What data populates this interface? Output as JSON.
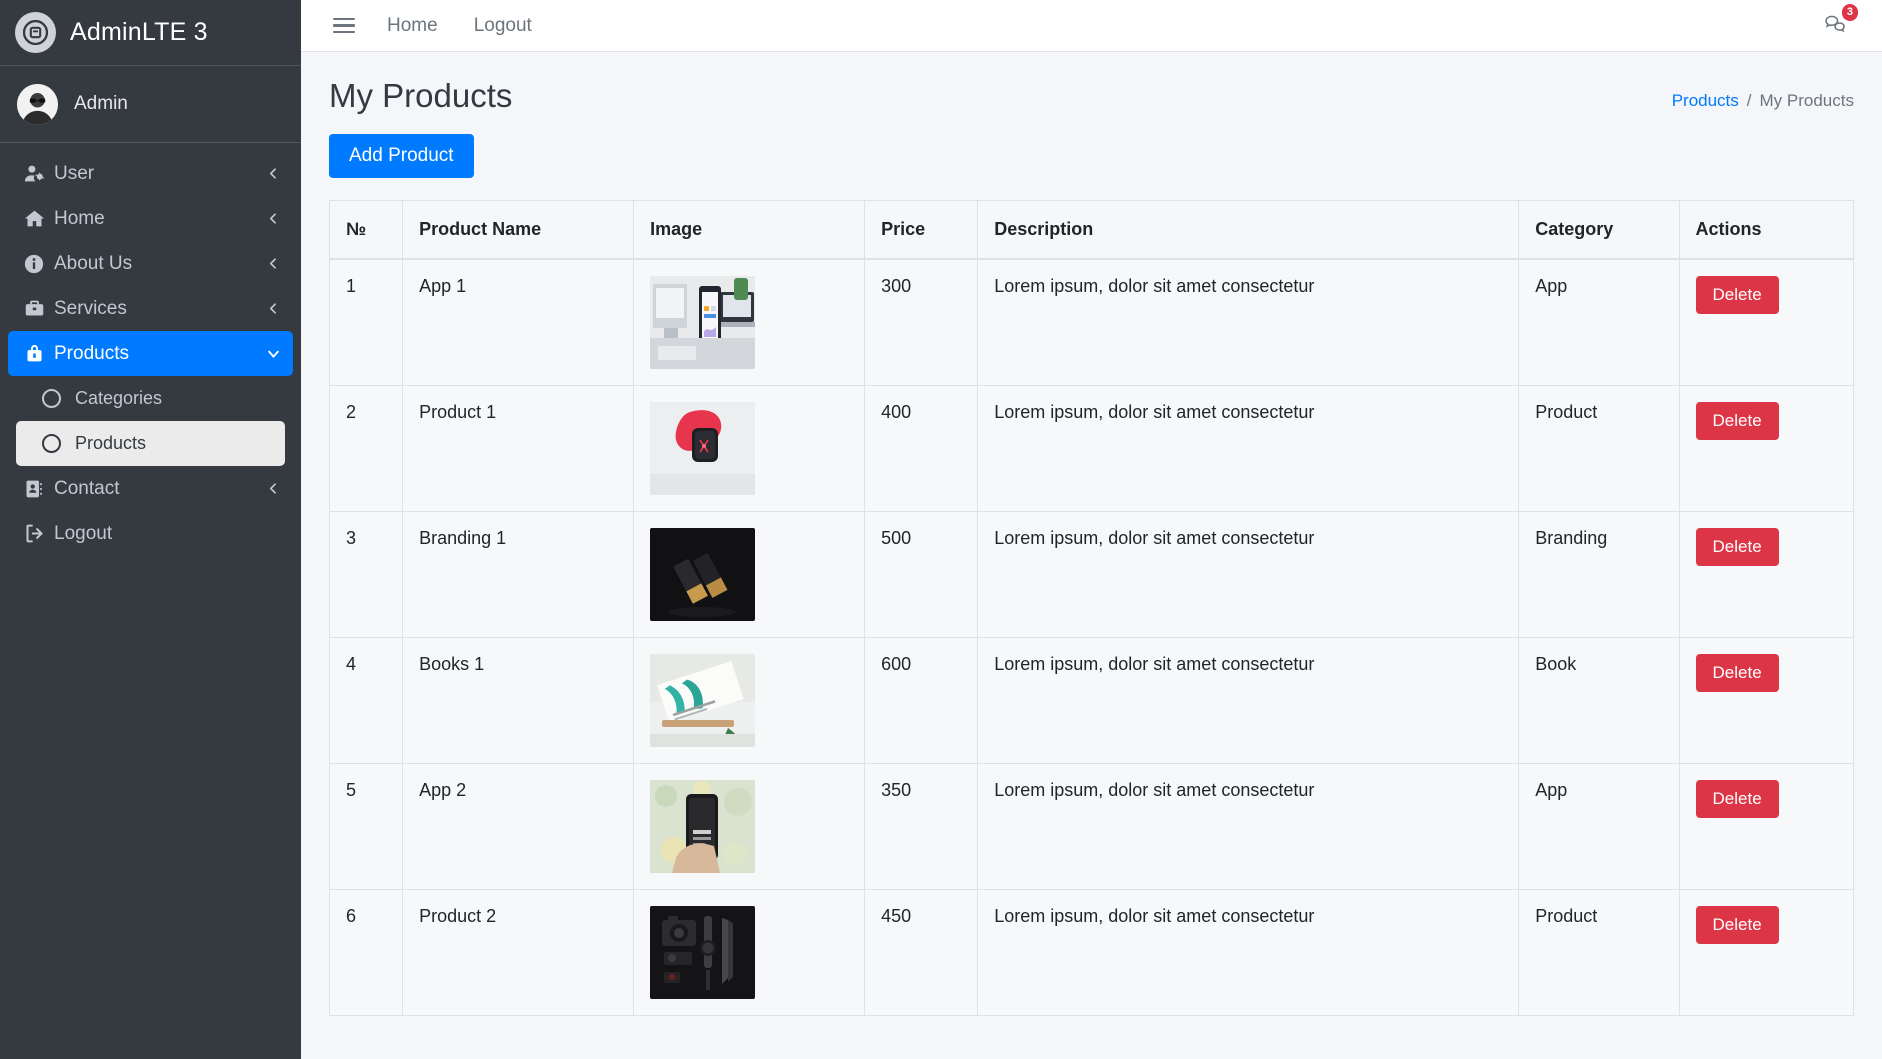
{
  "brand": {
    "title": "AdminLTE 3",
    "logo_icon": "adminlte-logo-icon"
  },
  "user_panel": {
    "name": "Admin",
    "avatar_icon": "user-avatar"
  },
  "sidebar": {
    "items": [
      {
        "label": "User",
        "icon": "user-cog-icon",
        "arrow": "chevron-left-icon",
        "active": false
      },
      {
        "label": "Home",
        "icon": "home-icon",
        "arrow": "chevron-left-icon",
        "active": false
      },
      {
        "label": "About Us",
        "icon": "info-circle-icon",
        "arrow": "chevron-left-icon",
        "active": false
      },
      {
        "label": "Services",
        "icon": "briefcase-icon",
        "arrow": "chevron-left-icon",
        "active": false
      },
      {
        "label": "Products",
        "icon": "lock-bag-icon",
        "arrow": "chevron-down-icon",
        "active": true
      },
      {
        "label": "Contact",
        "icon": "address-book-icon",
        "arrow": "chevron-left-icon",
        "active": false
      },
      {
        "label": "Logout",
        "icon": "sign-out-icon",
        "arrow": "",
        "active": false
      }
    ],
    "sub_items": [
      {
        "label": "Categories",
        "icon": "circle-icon",
        "active": false
      },
      {
        "label": "Products",
        "icon": "circle-icon",
        "active": true
      }
    ]
  },
  "navbar": {
    "burger_icon": "hamburger-menu-icon",
    "links": [
      {
        "label": "Home"
      },
      {
        "label": "Logout"
      }
    ],
    "messages_icon": "comments-icon",
    "messages_badge": "3"
  },
  "header": {
    "title": "My Products",
    "breadcrumb": {
      "parent": "Products",
      "separator": "/",
      "current": "My Products"
    }
  },
  "toolbar": {
    "add_label": "Add Product"
  },
  "table": {
    "columns": [
      "№",
      "Product Name",
      "Image",
      "Price",
      "Description",
      "Category",
      "Actions"
    ],
    "action_label": "Delete",
    "rows": [
      {
        "num": "1",
        "name": "App 1",
        "image": "phone-laptop-photo",
        "price": "300",
        "description": "Lorem ipsum, dolor sit amet consectetur",
        "category": "App"
      },
      {
        "num": "2",
        "name": "Product 1",
        "image": "red-smartwatch-photo",
        "price": "400",
        "description": "Lorem ipsum, dolor sit amet consectetur",
        "category": "Product"
      },
      {
        "num": "3",
        "name": "Branding 1",
        "image": "dark-bottles-photo",
        "price": "500",
        "description": "Lorem ipsum, dolor sit amet consectetur",
        "category": "Branding"
      },
      {
        "num": "4",
        "name": "Books 1",
        "image": "open-book-photo",
        "price": "600",
        "description": "Lorem ipsum, dolor sit amet consectetur",
        "category": "Book"
      },
      {
        "num": "5",
        "name": "App 2",
        "image": "hand-phone-plants-photo",
        "price": "350",
        "description": "Lorem ipsum, dolor sit amet consectetur",
        "category": "App"
      },
      {
        "num": "6",
        "name": "Product 2",
        "image": "camera-flatlay-photo",
        "price": "450",
        "description": "Lorem ipsum, dolor sit amet consectetur",
        "category": "Product"
      }
    ]
  },
  "colors": {
    "sidebar_bg": "#343a40",
    "accent_primary": "#007bff",
    "danger": "#dc3545",
    "content_bg": "#f4f6f9"
  }
}
